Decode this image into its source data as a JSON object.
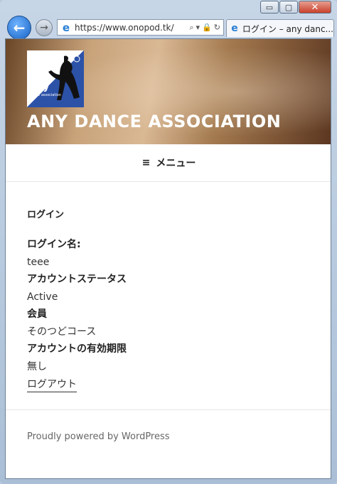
{
  "browser": {
    "window_buttons": {
      "minimize": "▭",
      "maximize": "▢",
      "close": "✕"
    },
    "back_icon": "←",
    "forward_icon": "→",
    "address": "https://www.onopod.tk/",
    "address_tools": {
      "search": "⌕",
      "dropdown": "▾",
      "lock": "🔒",
      "refresh": "↻"
    },
    "tab_title": "ログイン – any danc..."
  },
  "site": {
    "logo_text": "any",
    "logo_sub": "dance association",
    "title": "ANY DANCE ASSOCIATION",
    "menu_icon": "≡",
    "menu_label": "メニュー"
  },
  "page": {
    "title": "ログイン",
    "fields": [
      {
        "label": "ログイン名:",
        "value": "teee"
      },
      {
        "label": "アカウントステータス",
        "value": "Active"
      },
      {
        "label": "会員",
        "value": "そのつどコース"
      },
      {
        "label": "アカウントの有効期限",
        "value": "無し"
      }
    ],
    "logout": "ログアウト"
  },
  "footer": {
    "powered": "Proudly powered by WordPress"
  }
}
